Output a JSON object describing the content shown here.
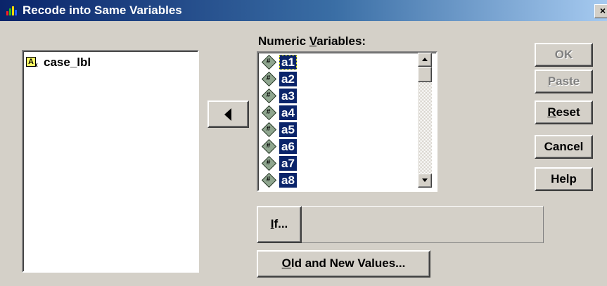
{
  "window": {
    "title": "Recode into Same Variables",
    "close_glyph": "×",
    "app_icon": "spss-app-icon"
  },
  "left_list": {
    "items": [
      {
        "label": "case_lbl",
        "icon": "string-variable-icon",
        "icon_glyph": "A"
      }
    ]
  },
  "move_button": {
    "icon": "left-arrow-icon"
  },
  "numeric_variables": {
    "label_prefix": "Numeric ",
    "label_mnemonic": "V",
    "label_suffix": "ariables:",
    "items": [
      {
        "label": "a1",
        "icon": "numeric-variable-icon",
        "selected": true,
        "focused": true
      },
      {
        "label": "a2",
        "icon": "numeric-variable-icon",
        "selected": true
      },
      {
        "label": "a3",
        "icon": "numeric-variable-icon",
        "selected": true
      },
      {
        "label": "a4",
        "icon": "numeric-variable-icon",
        "selected": true
      },
      {
        "label": "a5",
        "icon": "numeric-variable-icon",
        "selected": true
      },
      {
        "label": "a6",
        "icon": "numeric-variable-icon",
        "selected": true
      },
      {
        "label": "a7",
        "icon": "numeric-variable-icon",
        "selected": true
      },
      {
        "label": "a8",
        "icon": "numeric-variable-icon",
        "selected": true
      }
    ]
  },
  "buttons": {
    "ok": {
      "label": "OK",
      "enabled": false
    },
    "paste": {
      "mnemonic": "P",
      "rest": "aste",
      "enabled": false
    },
    "reset": {
      "mnemonic": "R",
      "rest": "eset",
      "enabled": true
    },
    "cancel": {
      "label": "Cancel",
      "enabled": true
    },
    "help": {
      "label": "Help",
      "enabled": true
    },
    "if": {
      "mnemonic": "I",
      "rest": "f..."
    },
    "old_new": {
      "mnemonic": "O",
      "rest": "ld and New Values..."
    }
  },
  "colors": {
    "face": "#d4d0c8",
    "selection": "#0a246a",
    "title_gradient_start": "#0a246a",
    "title_gradient_end": "#a6caf0"
  }
}
